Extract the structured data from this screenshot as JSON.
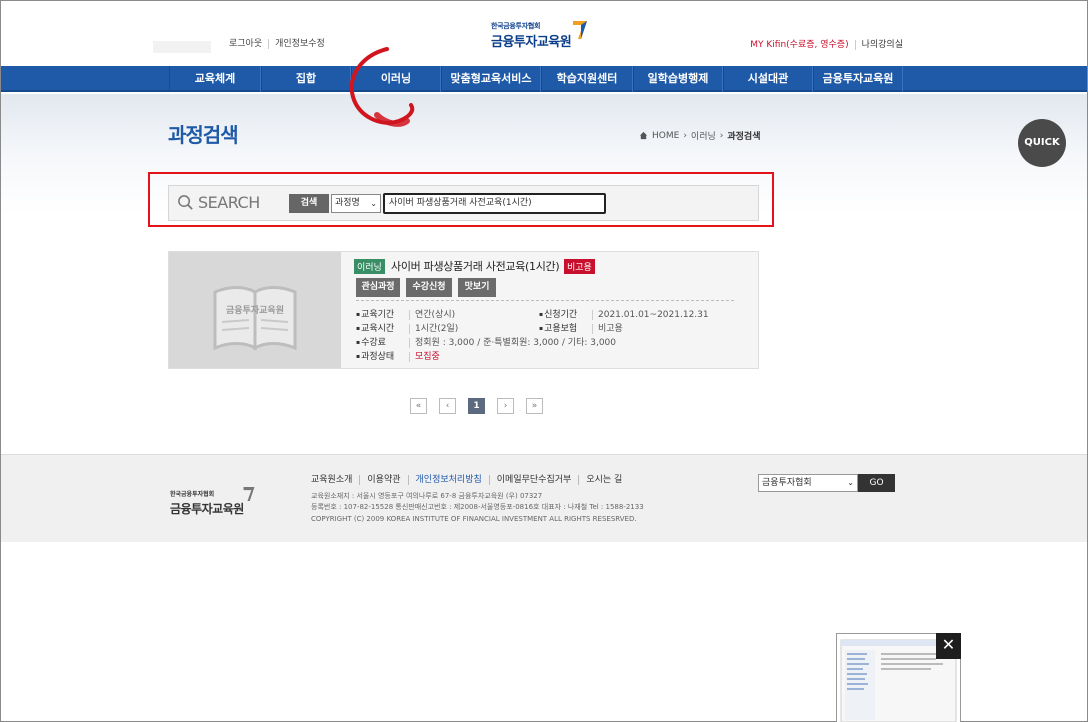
{
  "header": {
    "utility_left": [
      "로그아웃",
      "개인정보수정"
    ],
    "utility_right": [
      "MY Kifin(수료증, 영수증)",
      "나의강의실"
    ],
    "logo_small": "한국금융투자협회",
    "logo_big": "금융투자교육원"
  },
  "nav": {
    "items": [
      "교육체계",
      "집합",
      "이러닝",
      "맞춤형교육서비스",
      "학습지원센터",
      "일학습병행제",
      "시설대관",
      "금융투자교육원"
    ]
  },
  "page": {
    "title": "과정검색",
    "breadcrumb": [
      "HOME",
      "이러닝",
      "과정검색"
    ],
    "quick": "QUICK"
  },
  "search": {
    "label": "SEARCH",
    "button": "검색",
    "select_value": "과정명",
    "input_value": "사이버 파생상품거래 사전교육(1시간)"
  },
  "result": {
    "tag": "이러닝",
    "title": "사이버 파생상품거래 사전교육(1시간)",
    "badge": "비고용",
    "buttons": [
      "관심과정",
      "수강신청",
      "맛보기"
    ],
    "thumb_text": "금융투자교육원",
    "fields": {
      "period_label": "교육기간",
      "period_value": "연간(상시)",
      "apply_label": "신청기간",
      "apply_value": "2021.01.01~2021.12.31",
      "time_label": "교육시간",
      "time_value": "1시간(2일)",
      "insurance_label": "고용보험",
      "insurance_value": "비고용",
      "fee_label": "수강료",
      "fee_value": "정회원 : 3,000 / 준·특별회원: 3,000 / 기타: 3,000",
      "status_label": "과정상태",
      "status_value": "모집중"
    }
  },
  "pager": {
    "first": "«",
    "prev": "‹",
    "current": "1",
    "next": "›",
    "last": "»"
  },
  "footer": {
    "logo_small": "한국금융투자협회",
    "logo_big": "금융투자교육원",
    "links": [
      "교육원소개",
      "이용약관",
      "개인정보처리방침",
      "이메일무단수집거부",
      "오시는 길"
    ],
    "address": "교육원소재지 : 서울시 영등포구 여의나루로 67-8 금융투자교육원 (우) 07327",
    "registration": "등록번호 : 107-82-15528 통신판매신고번호 : 제2008-서울영등포-0816호 대표자 : 나재철 Tel : 1588-2133",
    "copyright": "COPYRIGHT (C) 2009 KOREA INSTITUTE OF FINANCIAL INVESTMENT ALL RIGHTS RESESRVED.",
    "site_select": "금융투자협회",
    "go": "GO"
  },
  "popup": {
    "close": "✕"
  }
}
